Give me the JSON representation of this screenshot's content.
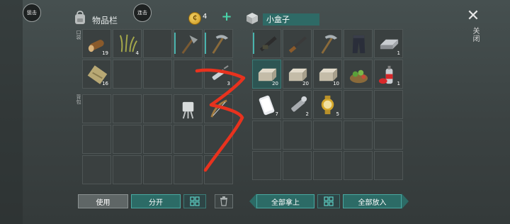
{
  "left_buttons": {
    "skill1": "狙击",
    "skill2": "连击"
  },
  "inventory": {
    "title": "物品栏",
    "pocket_label": "口袋",
    "backpack_label": "背包",
    "coins": "4",
    "plus": "+",
    "pocket_rows": [
      [
        {
          "icon": "log-icon",
          "qty": "19"
        },
        {
          "icon": "grass-icon",
          "qty": "4"
        },
        {
          "icon": "empty",
          "qty": ""
        },
        {
          "icon": "stone-axe-icon",
          "qty": "",
          "bar": true
        },
        {
          "icon": "pickaxe-icon",
          "qty": "",
          "bar": true
        }
      ],
      [
        {
          "icon": "rope-bundle-icon",
          "qty": "16"
        },
        {
          "icon": "empty",
          "qty": ""
        },
        {
          "icon": "empty",
          "qty": ""
        },
        {
          "icon": "empty",
          "qty": ""
        },
        {
          "icon": "syringe-icon",
          "qty": "3"
        }
      ]
    ],
    "backpack_rows": [
      [
        {
          "icon": "empty",
          "qty": ""
        },
        {
          "icon": "empty",
          "qty": ""
        },
        {
          "icon": "empty",
          "qty": ""
        },
        {
          "icon": "battery-clip-icon",
          "qty": ""
        },
        {
          "icon": "bow-icon",
          "qty": "",
          "dots": true
        }
      ],
      [
        {
          "icon": "empty",
          "qty": ""
        },
        {
          "icon": "empty",
          "qty": ""
        },
        {
          "icon": "empty",
          "qty": ""
        },
        {
          "icon": "empty",
          "qty": ""
        },
        {
          "icon": "empty",
          "qty": ""
        }
      ],
      [
        {
          "icon": "empty",
          "qty": ""
        },
        {
          "icon": "empty",
          "qty": ""
        },
        {
          "icon": "empty",
          "qty": ""
        },
        {
          "icon": "empty",
          "qty": ""
        },
        {
          "icon": "empty",
          "qty": ""
        }
      ]
    ],
    "use_label": "使用",
    "split_label": "分开",
    "sort_icon": "grid-sort-icon",
    "trash_icon": "trash-icon"
  },
  "box": {
    "title": "小盒子",
    "close_label": "关闭",
    "rows": [
      [
        {
          "icon": "assault-rifle-icon",
          "qty": "",
          "bar": true
        },
        {
          "icon": "rifle-icon",
          "qty": "",
          "dots": true
        },
        {
          "icon": "pickaxe-icon",
          "qty": "",
          "dots": true
        },
        {
          "icon": "armor-pants-icon",
          "qty": ""
        },
        {
          "icon": "metal-bar-icon",
          "qty": "1"
        }
      ],
      [
        {
          "icon": "stone-block-icon",
          "qty": "20",
          "hl": true
        },
        {
          "icon": "stone-block-icon",
          "qty": "20"
        },
        {
          "icon": "stone-block-icon",
          "qty": "10"
        },
        {
          "icon": "herb-pile-icon",
          "qty": ""
        },
        {
          "icon": "spray-can-icon",
          "qty": "1"
        }
      ],
      [
        {
          "icon": "phone-icon",
          "qty": "7"
        },
        {
          "icon": "flashlight-icon",
          "qty": "2"
        },
        {
          "icon": "gold-watch-icon",
          "qty": "5"
        },
        {
          "icon": "empty",
          "qty": ""
        },
        {
          "icon": "empty",
          "qty": ""
        }
      ],
      [
        {
          "icon": "empty",
          "qty": ""
        },
        {
          "icon": "empty",
          "qty": ""
        },
        {
          "icon": "empty",
          "qty": ""
        },
        {
          "icon": "empty",
          "qty": ""
        },
        {
          "icon": "empty",
          "qty": ""
        }
      ],
      [
        {
          "icon": "empty",
          "qty": ""
        },
        {
          "icon": "empty",
          "qty": ""
        },
        {
          "icon": "empty",
          "qty": ""
        },
        {
          "icon": "empty",
          "qty": ""
        },
        {
          "icon": "empty",
          "qty": ""
        }
      ]
    ],
    "take_all_label": "全部拿上",
    "put_all_label": "全部放入"
  },
  "colors": {
    "accent": "#2c6b66",
    "annotation": "#e8321e"
  }
}
